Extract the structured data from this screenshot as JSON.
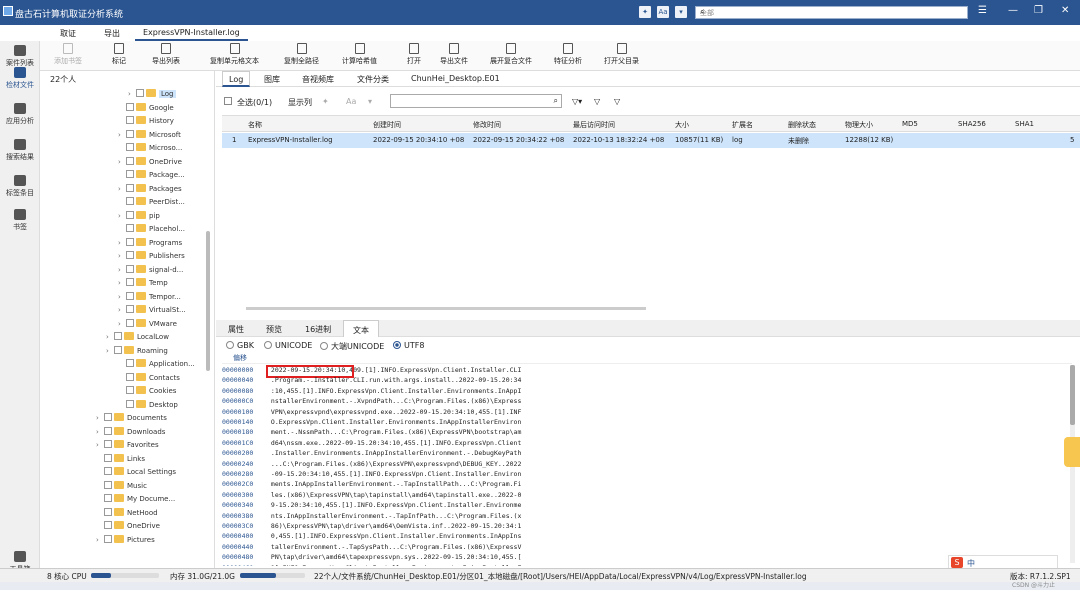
{
  "app": {
    "title": "盘古石计算机取证分析系统",
    "search_placeholder": "全部"
  },
  "title_icons": [
    "pin-icon",
    "font-icon",
    "hex-icon"
  ],
  "menu_tabs": [
    "取证",
    "导出",
    "ExpressVPN-Installer.log"
  ],
  "toolbar": [
    {
      "label": "添加书签",
      "icon": "bookmark-add-icon",
      "disabled": true
    },
    {
      "label": "标记",
      "icon": "flag-icon",
      "disabled": false
    },
    {
      "label": "导出列表",
      "icon": "export-list-icon",
      "disabled": false
    },
    {
      "label": "复制单元格文本",
      "icon": "copy-cell-icon",
      "disabled": false
    },
    {
      "label": "复制全路径",
      "icon": "copy-path-icon",
      "disabled": false
    },
    {
      "label": "计算哈希值",
      "icon": "hash-icon",
      "disabled": false
    },
    {
      "label": "打开",
      "icon": "open-icon",
      "disabled": false
    },
    {
      "label": "导出文件",
      "icon": "export-file-icon",
      "disabled": false
    },
    {
      "label": "展开复合文件",
      "icon": "expand-compound-icon",
      "disabled": false
    },
    {
      "label": "特征分析",
      "icon": "feature-analysis-icon",
      "disabled": false
    },
    {
      "label": "打开父目录",
      "icon": "open-parent-icon",
      "disabled": false
    }
  ],
  "leftnav": [
    {
      "label": "案件列表",
      "icon": "case-list-icon",
      "active": false
    },
    {
      "label": "检材文件",
      "icon": "evidence-icon",
      "active": true
    },
    {
      "label": "应用分析",
      "icon": "app-analysis-icon",
      "active": false
    },
    {
      "label": "搜索结果",
      "icon": "search-results-icon",
      "active": false
    },
    {
      "label": "标签条目",
      "icon": "tag-icon",
      "active": false
    },
    {
      "label": "书签",
      "icon": "bookmark-icon",
      "active": false
    },
    {
      "label": "工具箱",
      "icon": "toolbox-icon",
      "active": false
    }
  ],
  "tree": {
    "header": "22个人",
    "items": [
      {
        "label": "Log",
        "expanded": true,
        "selected": true
      },
      {
        "label": "Google",
        "expanded": false
      },
      {
        "label": "History",
        "expanded": false
      },
      {
        "label": "Microsoft",
        "expanded": true
      },
      {
        "label": "Microso...",
        "expanded": false
      },
      {
        "label": "OneDrive",
        "expanded": true
      },
      {
        "label": "Package...",
        "expanded": false
      },
      {
        "label": "Packages",
        "expanded": true
      },
      {
        "label": "PeerDist...",
        "expanded": false
      },
      {
        "label": "pip",
        "expanded": true
      },
      {
        "label": "Placehol...",
        "expanded": false
      },
      {
        "label": "Programs",
        "expanded": true
      },
      {
        "label": "Publishers",
        "expanded": true
      },
      {
        "label": "signal-d...",
        "expanded": true
      },
      {
        "label": "Temp",
        "expanded": true
      },
      {
        "label": "Tempor...",
        "expanded": true
      },
      {
        "label": "VirtualSt...",
        "expanded": true
      },
      {
        "label": "VMware",
        "expanded": true
      },
      {
        "label": "LocalLow",
        "expanded": true
      },
      {
        "label": "Roaming",
        "expanded": true
      },
      {
        "label": "Application...",
        "expanded": false
      },
      {
        "label": "Contacts",
        "expanded": false
      },
      {
        "label": "Cookies",
        "expanded": false
      },
      {
        "label": "Desktop",
        "expanded": false
      },
      {
        "label": "Documents",
        "expanded": true
      },
      {
        "label": "Downloads",
        "expanded": true
      },
      {
        "label": "Favorites",
        "expanded": true
      },
      {
        "label": "Links",
        "expanded": false
      },
      {
        "label": "Local Settings",
        "expanded": false
      },
      {
        "label": "Music",
        "expanded": false
      },
      {
        "label": "My Docume...",
        "expanded": false
      },
      {
        "label": "NetHood",
        "expanded": false
      },
      {
        "label": "OneDrive",
        "expanded": false
      },
      {
        "label": "Pictures",
        "expanded": true
      }
    ]
  },
  "subtabs": [
    "Log",
    "图库",
    "音视频库",
    "文件分类",
    "ChunHei_Desktop.E01"
  ],
  "filter": {
    "select_all": "全选(0/1)",
    "display_col": "显示列"
  },
  "grid": {
    "headers": [
      "名称",
      "创建时间",
      "修改时间",
      "最后访问时间",
      "大小",
      "扩展名",
      "删除状态",
      "物理大小",
      "MD5",
      "SHA256",
      "SHA1"
    ],
    "row": {
      "index": "1",
      "name": "ExpressVPN-Installer.log",
      "created": "2022-09-15 20:34:10 +08",
      "modified": "2022-09-15 20:34:22 +08",
      "accessed": "2022-10-13 18:32:24 +08",
      "size": "10857(11 KB)",
      "ext": "log",
      "deleted": "未删除",
      "physical": "12288(12 KB)",
      "trailing": "5"
    }
  },
  "bottom_tabs": [
    "属性",
    "预览",
    "16进制",
    "文本"
  ],
  "encodings": [
    {
      "label": "GBK",
      "on": false
    },
    {
      "label": "UNICODE",
      "on": false
    },
    {
      "label": "大端UNICODE",
      "on": false
    },
    {
      "label": "UTF8",
      "on": true
    }
  ],
  "offset_header": "偏移",
  "hex_rows": [
    {
      "off": "00000000",
      "text": " 2022-09-15.20:34:10,409.[1].INFO.ExpressVpn.Client.Installer.CLI"
    },
    {
      "off": "00000040",
      "text": " .Program.-.Installer.CLI.run.with.args.install..2022-09-15.20:34"
    },
    {
      "off": "00000080",
      "text": " :10,455.[1].INFO.ExpressVpn.Client.Installer.Environments.InAppI"
    },
    {
      "off": "000000C0",
      "text": " nstallerEnvironment.-.XvpndPath...C:\\Program.Files.(x86)\\Express"
    },
    {
      "off": "00000100",
      "text": " VPN\\expressvpnd\\expressvpnd.exe..2022-09-15.20:34:10,455.[1].INF"
    },
    {
      "off": "00000140",
      "text": " O.ExpressVpn.Client.Installer.Environments.InAppInstallerEnviron"
    },
    {
      "off": "00000180",
      "text": " ment.-.NssmPath...C:\\Program.Files.(x86)\\ExpressVPN\\bootstrap\\am"
    },
    {
      "off": "000001C0",
      "text": " d64\\nssm.exe..2022-09-15.20:34:10,455.[1].INFO.ExpressVpn.Client"
    },
    {
      "off": "00000200",
      "text": " .Installer.Environments.InAppInstallerEnvironment.-.DebugKeyPath"
    },
    {
      "off": "00000240",
      "text": " ...C:\\Program.Files.(x86)\\ExpressVPN\\expressvpnd\\DEBUG_KEY..2022"
    },
    {
      "off": "00000280",
      "text": " -09-15.20:34:10,455.[1].INFO.ExpressVpn.Client.Installer.Environ"
    },
    {
      "off": "000002C0",
      "text": " ments.InAppInstallerEnvironment.-.TapInstallPath...C:\\Program.Fi"
    },
    {
      "off": "00000300",
      "text": " les.(x86)\\ExpressVPN\\tap\\tapinstall\\amd64\\tapinstall.exe..2022-0"
    },
    {
      "off": "00000340",
      "text": " 9-15.20:34:10,455.[1].INFO.ExpressVpn.Client.Installer.Environme"
    },
    {
      "off": "00000380",
      "text": " nts.InAppInstallerEnvironment.-.TapInfPath...C:\\Program.Files.(x"
    },
    {
      "off": "000003C0",
      "text": " 86)\\ExpressVPN\\tap\\driver\\amd64\\OemVista.inf..2022-09-15.20:34:1"
    },
    {
      "off": "00000400",
      "text": " 0,455.[1].INFO.ExpressVpn.Client.Installer.Environments.InAppIns"
    },
    {
      "off": "00000440",
      "text": " tallerEnvironment.-.TapSysPath...C:\\Program.Files.(x86)\\ExpressV"
    },
    {
      "off": "00000480",
      "text": " PN\\tap\\driver\\amd64\\tapexpressvpn.sys..2022-09-15.20:34:10,455.["
    },
    {
      "off": "000004C0",
      "text": " 1].INFO.ExpressVpn.Client.Installer.Environments.InAppInstallerE"
    }
  ],
  "status": {
    "cpu": "8 核心 CPU",
    "cpu_pct": 0.3,
    "mem": "内存 31.0G/21.0G",
    "mem_pct": 0.55,
    "path": "22个人/文件系统/ChunHei_Desktop.E01/分区01_本地磁盘/[Root]/Users/HEI/AppData/Local/ExpressVPN/v4/Log/ExpressVPN-Installer.log",
    "version": "版本: R7.1.2.SP1"
  },
  "ime": {
    "label": "中"
  },
  "watermark": "CSDN @斗力止",
  "colors": {
    "accent": "#2b5591",
    "selection": "#cde4fb",
    "highlight": "#e02020"
  }
}
